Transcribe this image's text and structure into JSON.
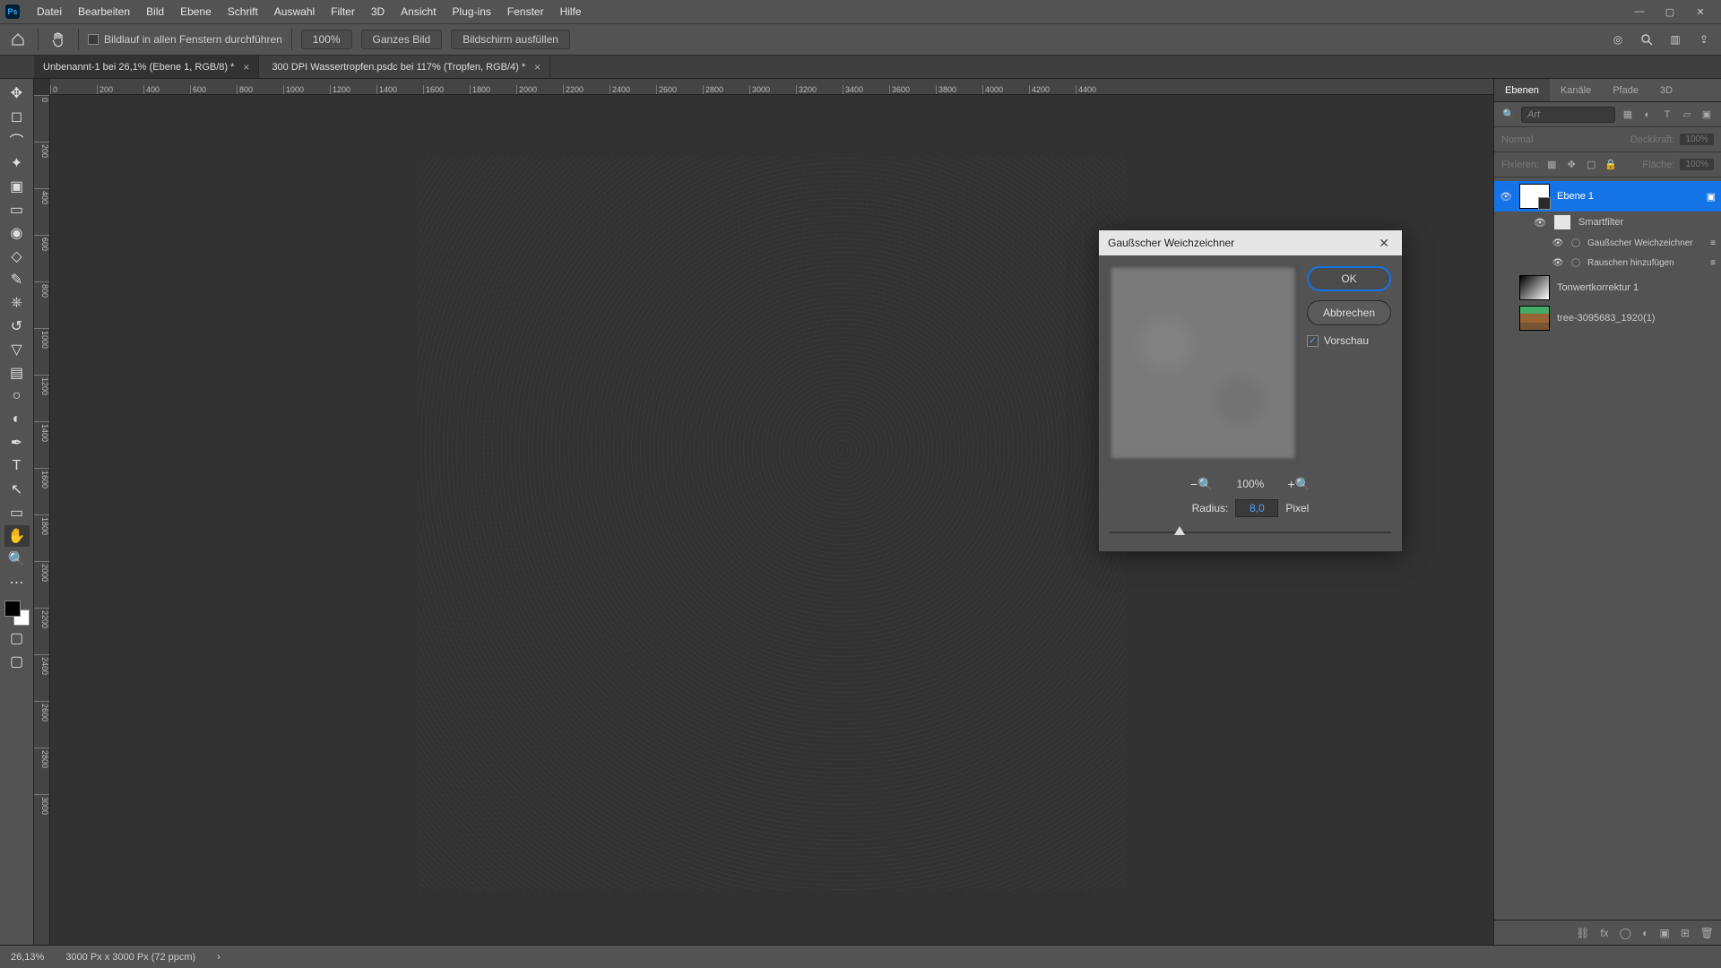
{
  "menubar": {
    "items": [
      "Datei",
      "Bearbeiten",
      "Bild",
      "Ebene",
      "Schrift",
      "Auswahl",
      "Filter",
      "3D",
      "Ansicht",
      "Plug-ins",
      "Fenster",
      "Hilfe"
    ]
  },
  "optbar": {
    "scroll_all": "Bildlauf in allen Fenstern durchführen",
    "hundred": "100%",
    "fit": "Ganzes Bild",
    "fill": "Bildschirm ausfüllen"
  },
  "tabs": [
    {
      "label": "Unbenannt-1 bei 26,1% (Ebene 1, RGB/8) *",
      "active": true
    },
    {
      "label": "300 DPI Wassertropfen.psdc bei 117% (Tropfen, RGB/4) *",
      "active": false
    }
  ],
  "ruler_h": [
    "0",
    "200",
    "400",
    "600",
    "800",
    "1000",
    "1200",
    "1400",
    "1600",
    "1800",
    "2000",
    "2200",
    "2400",
    "2600",
    "2800",
    "3000",
    "3200",
    "3400",
    "3600",
    "3800",
    "4000",
    "4200",
    "4400"
  ],
  "ruler_v": [
    "0",
    "200",
    "400",
    "600",
    "800",
    "1000",
    "1200",
    "1400",
    "1600",
    "1800",
    "2000",
    "2200",
    "2400",
    "2600",
    "2800",
    "3000"
  ],
  "panels": {
    "tabs": [
      "Ebenen",
      "Kanäle",
      "Pfade",
      "3D"
    ],
    "search_placeholder": "Art",
    "blend": "Normal",
    "opacity_label": "Deckkraft:",
    "opacity_val": "100%",
    "lock_label": "Fixieren:",
    "fill_label": "Fläche:",
    "fill_val": "100%",
    "layers": [
      {
        "name": "Ebene 1",
        "selected": true,
        "smart": true,
        "eye": true
      },
      {
        "name": "Smartfilter",
        "child": true,
        "eye": true,
        "kind": "sf"
      },
      {
        "name": "Gaußscher Weichzeichner",
        "grand": true,
        "eye": true,
        "kind": "fx"
      },
      {
        "name": "Rauschen hinzufügen",
        "grand": true,
        "eye": true,
        "kind": "fx"
      },
      {
        "name": "Tonwertkorrektur 1",
        "eye": false,
        "kind": "curves"
      },
      {
        "name": "tree-3095683_1920(1)",
        "eye": false,
        "kind": "img"
      }
    ]
  },
  "dialog": {
    "title": "Gaußscher Weichzeichner",
    "ok": "OK",
    "cancel": "Abbrechen",
    "preview_label": "Vorschau",
    "zoom": "100%",
    "radius_label": "Radius:",
    "radius_value": "8,0",
    "radius_unit": "Pixel"
  },
  "status": {
    "zoom": "26,13%",
    "info": "3000 Px x 3000 Px (72 ppcm)"
  }
}
